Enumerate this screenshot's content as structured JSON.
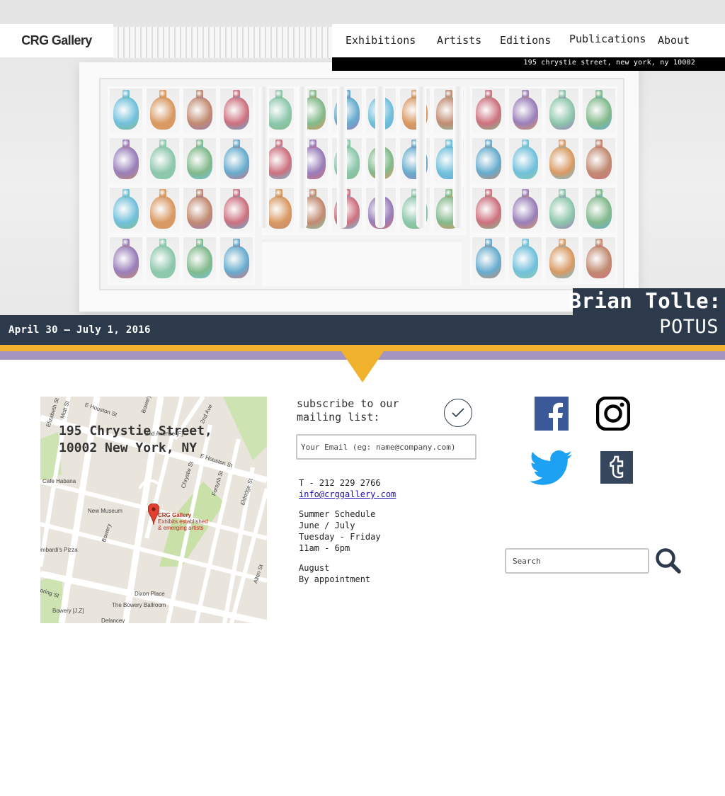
{
  "brand": {
    "logo_text": "CRG Gallery"
  },
  "nav": {
    "items": [
      {
        "label": "Exhibitions"
      },
      {
        "label": "Artists"
      },
      {
        "label": "Editions"
      },
      {
        "label": "Publications"
      },
      {
        "label": "About"
      }
    ]
  },
  "address_bar": {
    "text": "195 chrystie street, new york, ny 10002"
  },
  "exhibition": {
    "title_line1": "Brian Tolle:",
    "title_line2": "POTUS",
    "dates": "April 30 — July 1, 2016"
  },
  "map": {
    "address_line1": "195 Chrystie Street,",
    "address_line2": "10002 New York, NY",
    "labels": {
      "e_houston_st_top": "E Houston St",
      "bowery_top": "Bowery",
      "second_ave": "2nd Ave",
      "second_avenue_station": "2nd Avenue [F]",
      "e_houston_st": "E Houston St",
      "chrystie_st": "Chrystie St",
      "forsyth_st": "Forsyth St",
      "eldridge_st": "Eldridge St",
      "mott_st": "Mott St",
      "elizabeth_st": "Elizabeth St",
      "cafe_habana": "Cafe Habana",
      "new_museum": "New Museum",
      "bowery": "Bowery",
      "pin_title": "CRG Gallery",
      "pin_desc_1": "Exhibits established",
      "pin_desc_2": "& emerging artists",
      "lombardis": "Lombardi's Pizza",
      "allen_st": "Allen St",
      "dixon_place": "Dixon Place",
      "bowery_ballroom": "The Bowery Ballroom",
      "bowery_station": "Bowery [J,Z]",
      "delancey": "Delancey",
      "spring_st": "Spring St"
    }
  },
  "subscribe": {
    "label_line1": "subscribe to our",
    "label_line2": "mailing list:",
    "email_placeholder": "Your Email (eg: name@company.com)"
  },
  "contact": {
    "phone": "T - 212 229 2766",
    "email": "info@crggallery.com",
    "schedule_title": "Summer Schedule",
    "schedule_months": "June / July",
    "schedule_days": "Tuesday - Friday",
    "schedule_hours": "11am - 6pm",
    "august_label": "August",
    "august_note": "By appointment"
  },
  "social": {
    "facebook": "facebook-icon",
    "instagram": "instagram-icon",
    "twitter": "twitter-icon",
    "tumblr": "tumblr-icon"
  },
  "search": {
    "placeholder": "Search"
  },
  "colors": {
    "band": "#2c3a4c",
    "stripe_orange": "#f0b12d",
    "stripe_purple": "#a394c0",
    "facebook_blue": "#3b5998",
    "twitter_blue": "#1da1f2",
    "tumblr_navy": "#36465d"
  }
}
